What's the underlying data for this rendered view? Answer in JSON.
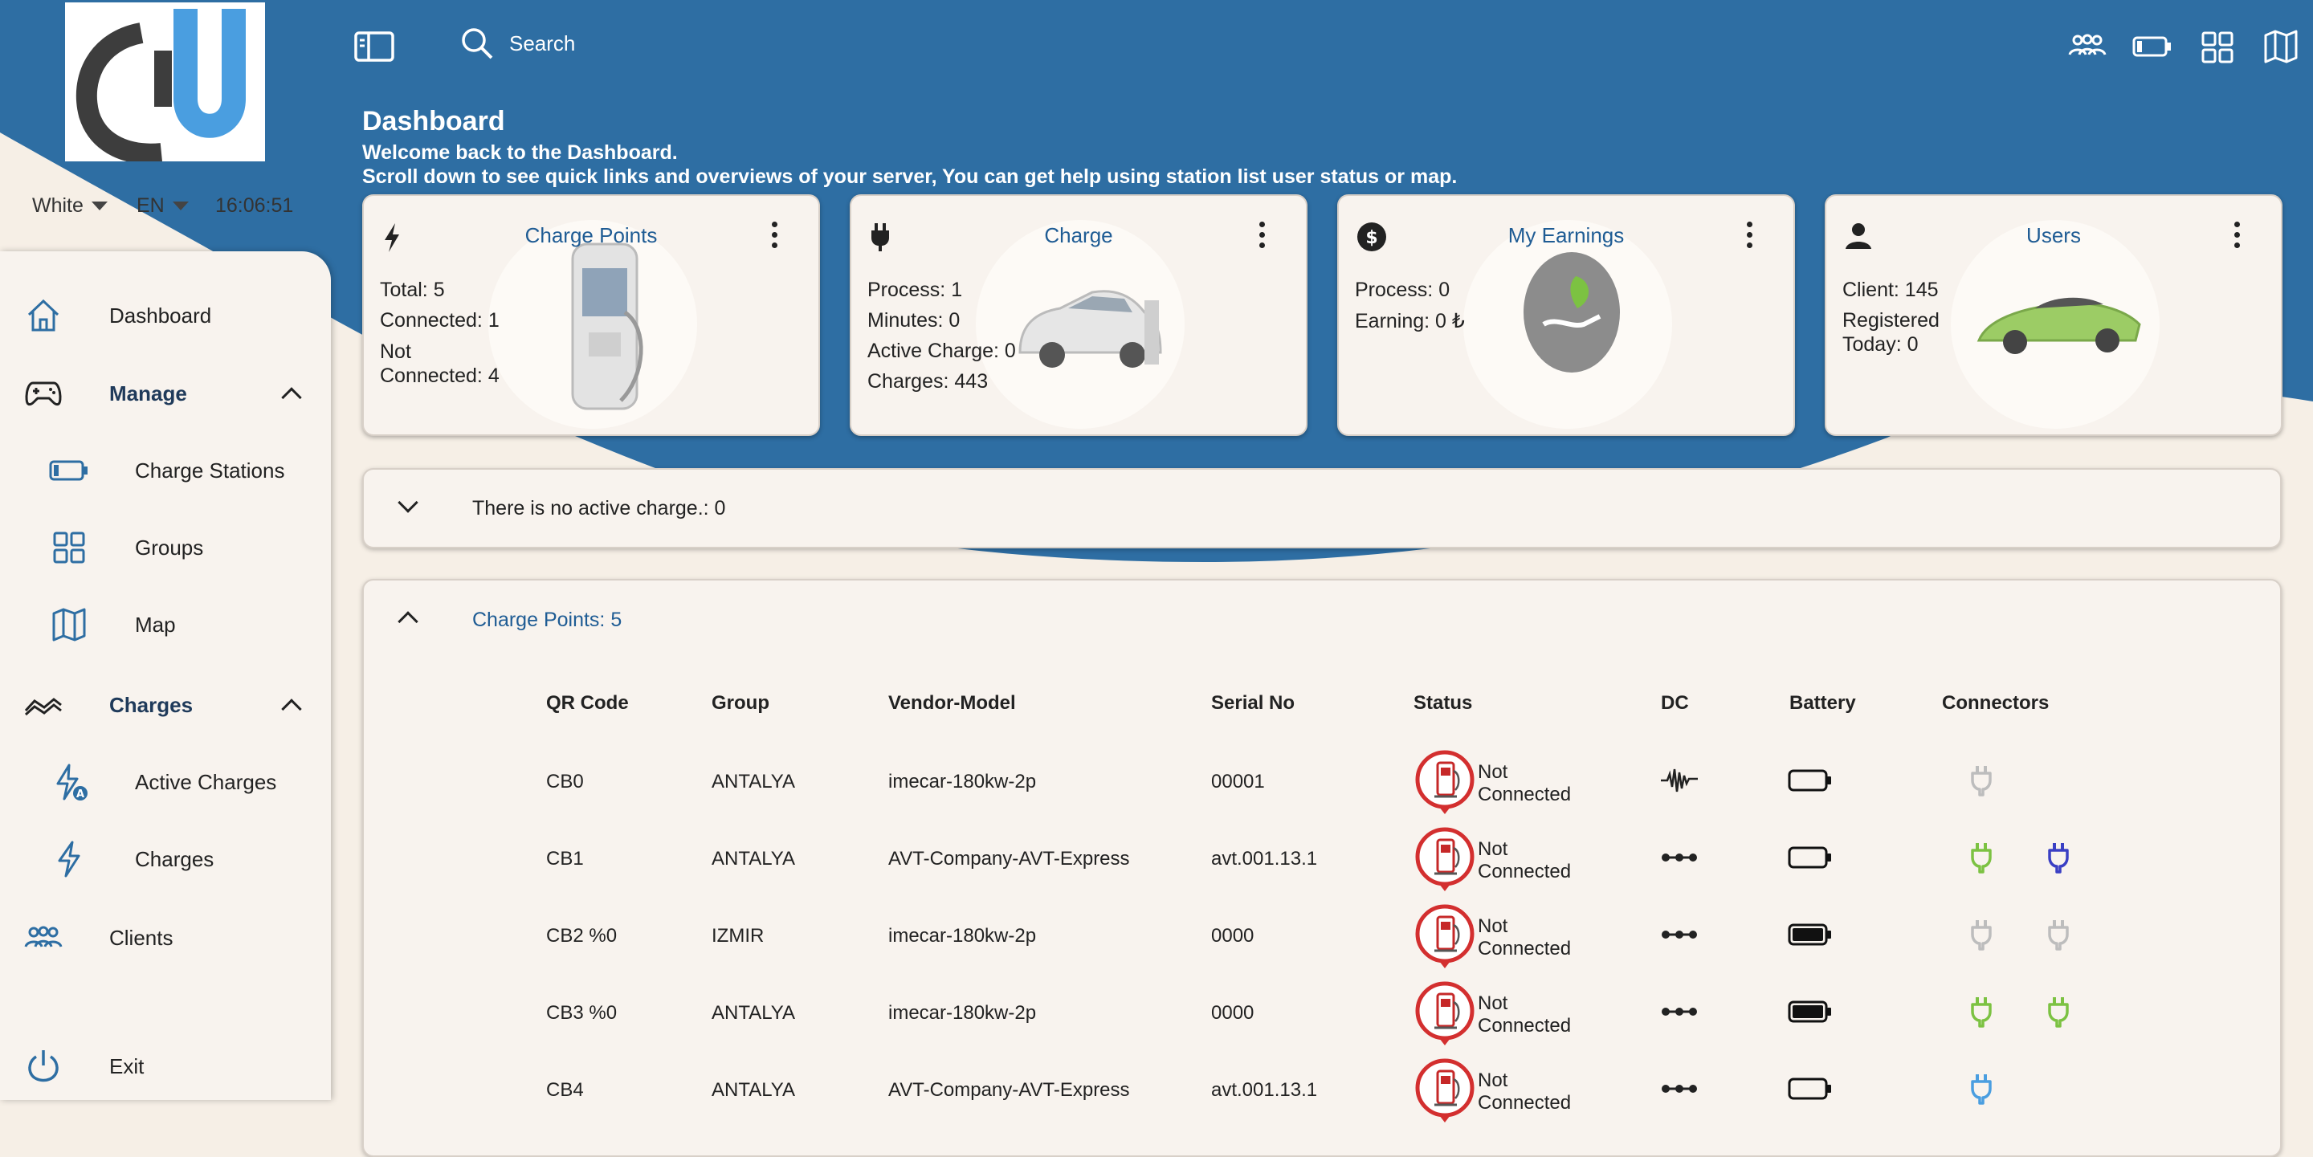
{
  "app": {
    "clock": "16:06:51",
    "theme_select": "White",
    "lang_select": "EN"
  },
  "header": {
    "search_label": "Search",
    "title": "Dashboard",
    "subtitle_1": "Welcome back to the Dashboard.",
    "subtitle_2": "Scroll down to see quick links and overviews of your server, You can get help using station list user status or map."
  },
  "sidebar": {
    "dashboard": "Dashboard",
    "manage": "Manage",
    "charge_stations": "Charge Stations",
    "groups": "Groups",
    "map": "Map",
    "charges_header": "Charges",
    "active_charges": "Active Charges",
    "charges": "Charges",
    "clients": "Clients",
    "exit": "Exit"
  },
  "cards": {
    "charge_points": {
      "title": "Charge Points",
      "l1": "Total: 5",
      "l2": "Connected: 1",
      "l3": "Not",
      "l4": "Connected: 4"
    },
    "charge": {
      "title": "Charge",
      "l1": "Process: 1",
      "l2": "Minutes: 0",
      "l3": "Active Charge: 0",
      "l4": "Charges: 443"
    },
    "earnings": {
      "title": "My Earnings",
      "l1": "Process: 0",
      "l2": "Earning: 0 ₺"
    },
    "users": {
      "title": "Users",
      "l1": "Client: 145",
      "l2": "Registered",
      "l3": "Today: 0"
    }
  },
  "active_panel": {
    "label": "There is no active charge.: 0"
  },
  "points_panel": {
    "label": "Charge Points: 5"
  },
  "table": {
    "headers": {
      "qr": "QR Code",
      "group": "Group",
      "vendor": "Vendor-Model",
      "serial": "Serial No",
      "status": "Status",
      "dc": "DC",
      "battery": "Battery",
      "connectors": "Connectors"
    },
    "rows": [
      {
        "qr": "CB0",
        "group": "ANTALYA",
        "vendor": "imecar-180kw-2p",
        "serial": "00001",
        "status1": "Not",
        "status2": "Connected",
        "dc": "wave",
        "battery": "empty",
        "connectors": [
          "#bdbdbd"
        ]
      },
      {
        "qr": "CB1",
        "group": "ANTALYA",
        "vendor": "AVT-Company-AVT-Express",
        "serial": "avt.001.13.1",
        "status1": "Not",
        "status2": "Connected",
        "dc": "dots",
        "battery": "empty",
        "connectors": [
          "#7cc242",
          "#3a3fc4"
        ]
      },
      {
        "qr": "CB2 %0",
        "group": "IZMIR",
        "vendor": "imecar-180kw-2p",
        "serial": "0000",
        "status1": "Not",
        "status2": "Connected",
        "dc": "dots",
        "battery": "full",
        "connectors": [
          "#bdbdbd",
          "#bdbdbd"
        ]
      },
      {
        "qr": "CB3 %0",
        "group": "ANTALYA",
        "vendor": "imecar-180kw-2p",
        "serial": "0000",
        "status1": "Not",
        "status2": "Connected",
        "dc": "dots",
        "battery": "full",
        "connectors": [
          "#7cc242",
          "#7cc242"
        ]
      },
      {
        "qr": "CB4",
        "group": "ANTALYA",
        "vendor": "AVT-Company-AVT-Express",
        "serial": "avt.001.13.1",
        "status1": "Not",
        "status2": "Connected",
        "dc": "dots",
        "battery": "empty",
        "connectors": [
          "#4a9ee0"
        ]
      }
    ]
  },
  "colors": {
    "primary": "#2e6ea3",
    "accent": "#1f5c94",
    "status_red": "#d32f2f"
  }
}
